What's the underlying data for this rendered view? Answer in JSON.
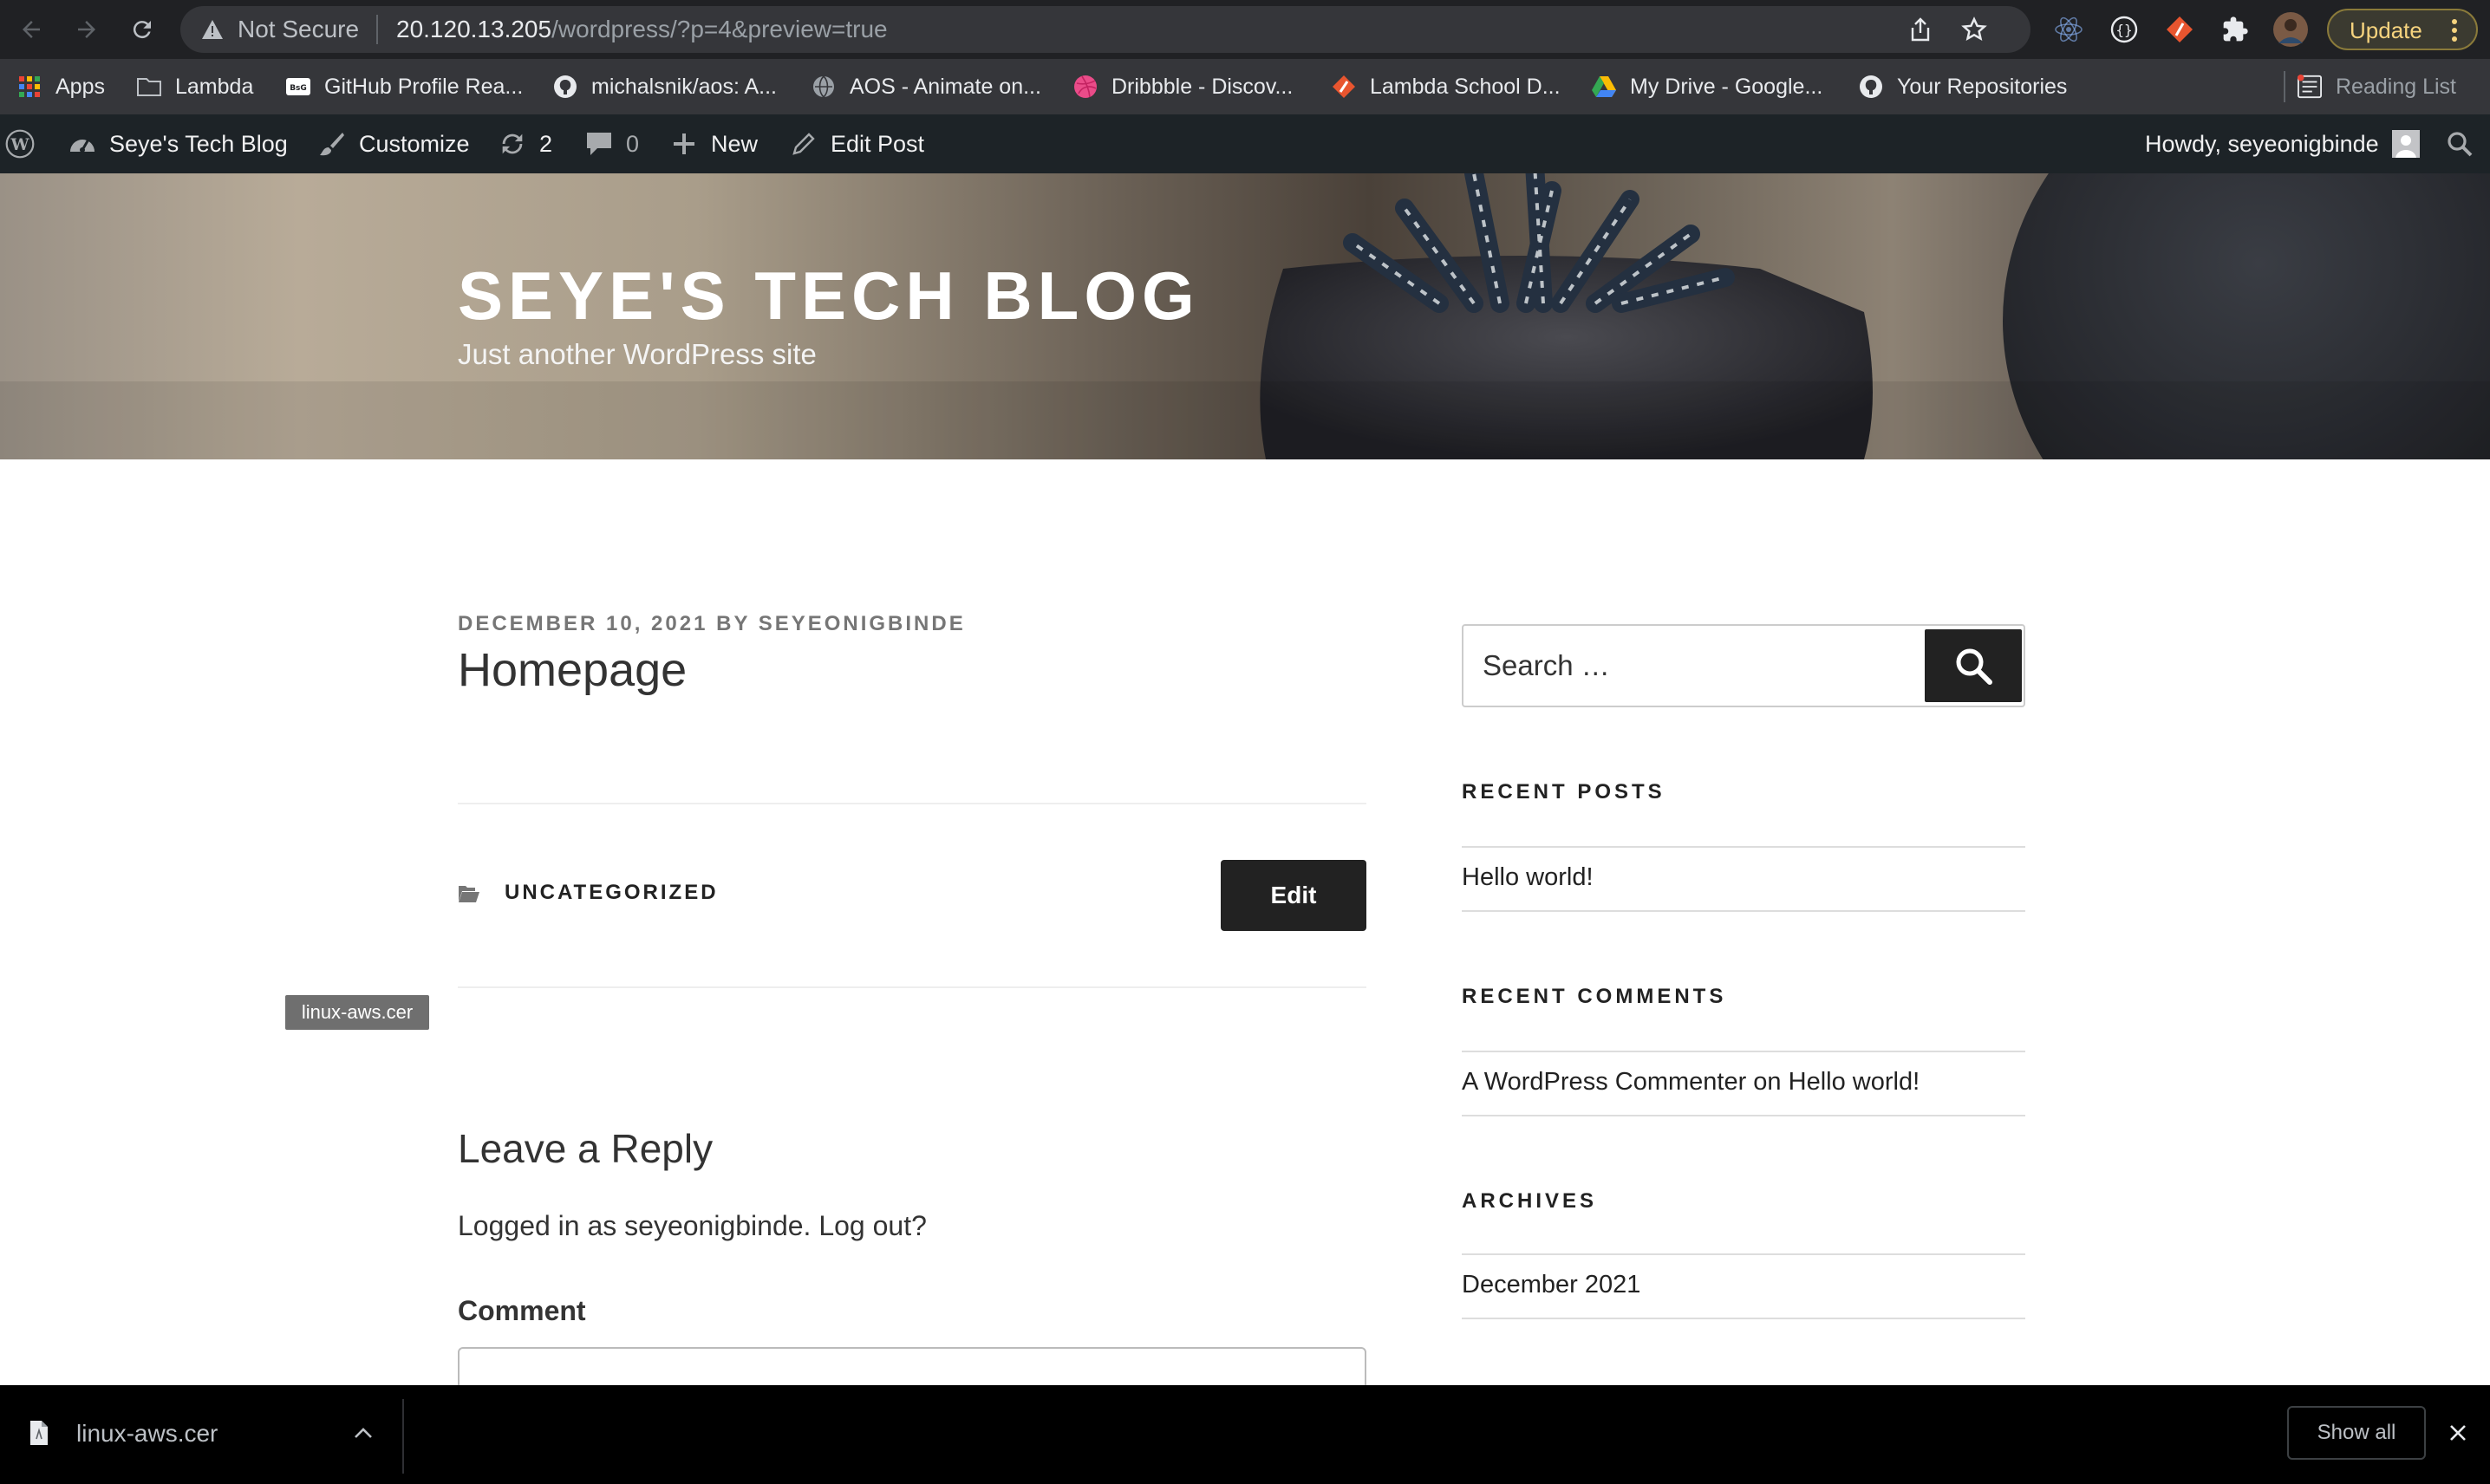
{
  "browser": {
    "security_label": "Not Secure",
    "url_host": "20.120.13.205",
    "url_path": "/wordpress/?p=4&preview=true",
    "update_label": "Update",
    "colors": {
      "toolbar": "#202124",
      "omnibox": "#35363a",
      "update_text": "#f6d37e"
    }
  },
  "bookmarks": {
    "items": [
      {
        "label": "Apps",
        "icon": "apps-grid-icon"
      },
      {
        "label": "Lambda",
        "icon": "folder-icon"
      },
      {
        "label": "GitHub Profile Rea...",
        "icon": "bsg-icon"
      },
      {
        "label": "michalsnik/aos: A...",
        "icon": "github-icon"
      },
      {
        "label": "AOS - Animate on...",
        "icon": "globe-icon"
      },
      {
        "label": "Dribbble - Discov...",
        "icon": "dribbble-icon"
      },
      {
        "label": "Lambda School D...",
        "icon": "lambda-icon"
      },
      {
        "label": "My Drive - Google...",
        "icon": "google-drive-icon"
      },
      {
        "label": "Your Repositories",
        "icon": "github-icon"
      }
    ],
    "reading_list": "Reading List"
  },
  "adminbar": {
    "site_name": "Seye's Tech Blog",
    "customize": "Customize",
    "updates_count": "2",
    "comments_count": "0",
    "new_label": "New",
    "edit_post": "Edit Post",
    "howdy": "Howdy, seyeonigbinde",
    "color": "#1d2327"
  },
  "header": {
    "title": "SEYE'S TECH BLOG",
    "description": "Just another WordPress site"
  },
  "post": {
    "date": "DECEMBER 10, 2021",
    "by": "BY",
    "author": "SEYEONIGBINDE",
    "title": "Homepage",
    "category": "UNCATEGORIZED",
    "edit_label": "Edit"
  },
  "tooltip": "linux-aws.cer",
  "reply": {
    "title": "Leave a Reply",
    "logged_in": "Logged in as seyeonigbinde. Log out?",
    "comment_label": "Comment"
  },
  "sidebar": {
    "search_placeholder": "Search …",
    "recent_posts_title": "RECENT POSTS",
    "recent_posts": [
      "Hello world!"
    ],
    "recent_comments_title": "RECENT COMMENTS",
    "recent_comment": {
      "author": "A WordPress Commenter",
      "on": "on",
      "post": "Hello world!"
    },
    "archives_title": "ARCHIVES",
    "archives": [
      "December 2021"
    ]
  },
  "downloads": {
    "filename": "linux-aws.cer",
    "show_all": "Show all"
  }
}
